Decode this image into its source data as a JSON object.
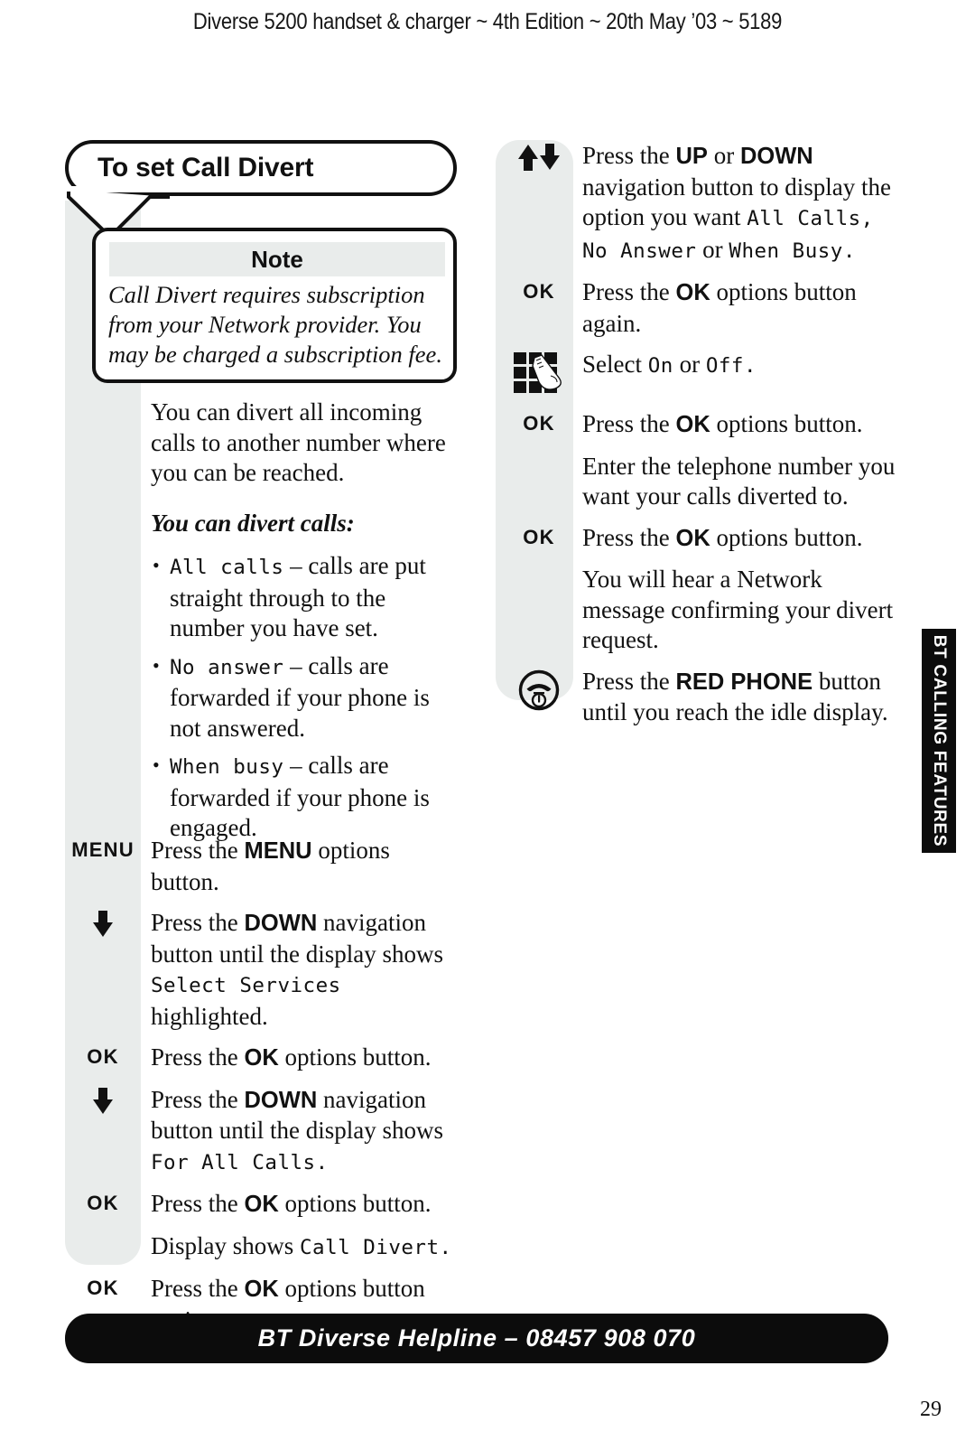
{
  "header": {
    "running_head": "Diverse 5200 handset & charger ~ 4th Edition ~ 20th May ’03 ~ 5189"
  },
  "title_callout": {
    "title": "To set Call Divert"
  },
  "note_box": {
    "heading": "Note",
    "body": "Call Divert requires subscription from your Network provider. You may be charged a subscription fee."
  },
  "left_column": {
    "intro": "You can divert all incoming calls to another number where you can be reached.",
    "lead_in": "You can divert calls:",
    "bullets": [
      {
        "lcd": "All calls",
        "rest": " – calls are put straight through to the number you have set."
      },
      {
        "lcd": "No answer",
        "rest": " – calls are forwarded if your phone is not answered."
      },
      {
        "lcd": "When busy",
        "rest": " – calls are forwarded if your phone is engaged."
      }
    ],
    "steps": [
      {
        "icon": "menu-key",
        "icon_label": "MENU",
        "text_pre": "Press the ",
        "text_bold": "MENU",
        "text_post": " options button.",
        "lcd": "",
        "text_tail": ""
      },
      {
        "icon": "down-arrow",
        "icon_label": "",
        "text_pre": "Press the ",
        "text_bold": "DOWN",
        "text_post": " navigation button until the display shows ",
        "lcd": "Select Services",
        "text_tail": " highlighted."
      },
      {
        "icon": "ok-key",
        "icon_label": "OK",
        "text_pre": "Press the ",
        "text_bold": "OK",
        "text_post": " options button.",
        "lcd": "",
        "text_tail": ""
      },
      {
        "icon": "down-arrow",
        "icon_label": "",
        "text_pre": "Press the ",
        "text_bold": "DOWN",
        "text_post": " navigation button until the display shows ",
        "lcd": "For All Calls.",
        "text_tail": ""
      },
      {
        "icon": "ok-key",
        "icon_label": "OK",
        "text_pre": "Press the ",
        "text_bold": "OK",
        "text_post": " options button.",
        "lcd": "",
        "text_tail": ""
      },
      {
        "icon": "none",
        "icon_label": "",
        "text_pre": "Display shows ",
        "text_bold": "",
        "text_post": "",
        "lcd": "Call Divert.",
        "text_tail": ""
      },
      {
        "icon": "ok-key",
        "icon_label": "OK",
        "text_pre": "Press the ",
        "text_bold": "OK",
        "text_post": " options button again.",
        "lcd": "",
        "text_tail": ""
      }
    ]
  },
  "right_column": {
    "steps": [
      {
        "icon": "up-down-arrows",
        "icon_label": "",
        "text_pre": "Press the ",
        "text_bold": "UP",
        "text_mid": " or ",
        "text_bold2": "DOWN",
        "text_post": " navigation button to display the option you want ",
        "lcd": "All Calls, No Answer",
        "text_tail": " or ",
        "lcd2": "When Busy.",
        "text_tail2": ""
      },
      {
        "icon": "ok-key",
        "icon_label": "OK",
        "text_pre": "Press the ",
        "text_bold": "OK",
        "text_post": " options button again.",
        "lcd": "",
        "text_tail": ""
      },
      {
        "icon": "keypad",
        "icon_label": "",
        "text_pre": "Select ",
        "text_bold": "",
        "text_post": "",
        "lcd": "On",
        "text_tail": " or ",
        "lcd2": "Off.",
        "text_tail2": ""
      },
      {
        "icon": "ok-key",
        "icon_label": "OK",
        "text_pre": "Press the ",
        "text_bold": "OK",
        "text_post": " options button.",
        "lcd": "",
        "text_tail": ""
      },
      {
        "icon": "none",
        "icon_label": "",
        "text_pre": "Enter the telephone number you want your calls diverted to.",
        "text_bold": "",
        "text_post": "",
        "lcd": "",
        "text_tail": ""
      },
      {
        "icon": "ok-key",
        "icon_label": "OK",
        "text_pre": "Press the ",
        "text_bold": "OK",
        "text_post": " options button.",
        "lcd": "",
        "text_tail": ""
      },
      {
        "icon": "none",
        "icon_label": "",
        "text_pre": "You will hear a Network message confirming your divert request.",
        "text_bold": "",
        "text_post": "",
        "lcd": "",
        "text_tail": ""
      },
      {
        "icon": "red-phone",
        "icon_label": "",
        "text_pre": "Press the ",
        "text_bold": "RED PHONE",
        "text_post": " button until you reach the idle display.",
        "lcd": "",
        "text_tail": ""
      }
    ]
  },
  "side_tab": {
    "label": "BT CALLING FEATURES"
  },
  "footer": {
    "helpline": "BT Diverse Helpline – 08457 908 070",
    "page_number": "29"
  },
  "colors": {
    "gutter_grey": "#e9eceb",
    "ink_black": "#111111",
    "bar_black": "#0c0c0c"
  }
}
